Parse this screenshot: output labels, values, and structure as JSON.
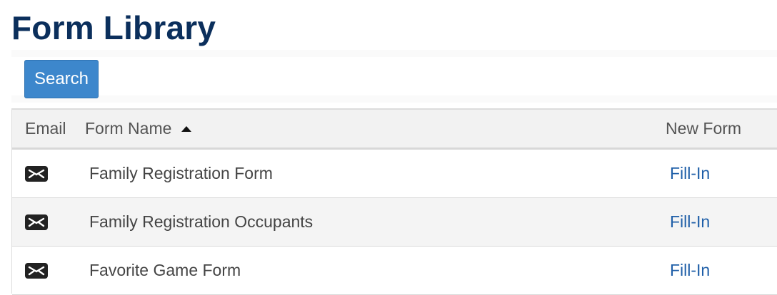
{
  "page": {
    "title": "Form Library"
  },
  "search": {
    "button_label": "Search"
  },
  "table": {
    "headers": {
      "email": "Email",
      "form_name": "Form Name",
      "new_form": "New Form"
    },
    "sort": {
      "column": "Form Name",
      "direction": "ascending",
      "icon": "sort-ascending-icon"
    },
    "rows": [
      {
        "email_icon": "mail-icon",
        "form_name": "Family Registration Form",
        "action": "Fill-In"
      },
      {
        "email_icon": "mail-icon",
        "form_name": "Family Registration Occupants",
        "action": "Fill-In"
      },
      {
        "email_icon": "mail-icon",
        "form_name": "Favorite Game Form",
        "action": "Fill-In"
      }
    ]
  },
  "colors": {
    "title": "#0b2f5c",
    "button_bg": "#3d87cc",
    "link": "#1f5fa8",
    "header_bg": "#f2f2f2",
    "alt_row_bg": "#f4f4f4"
  }
}
